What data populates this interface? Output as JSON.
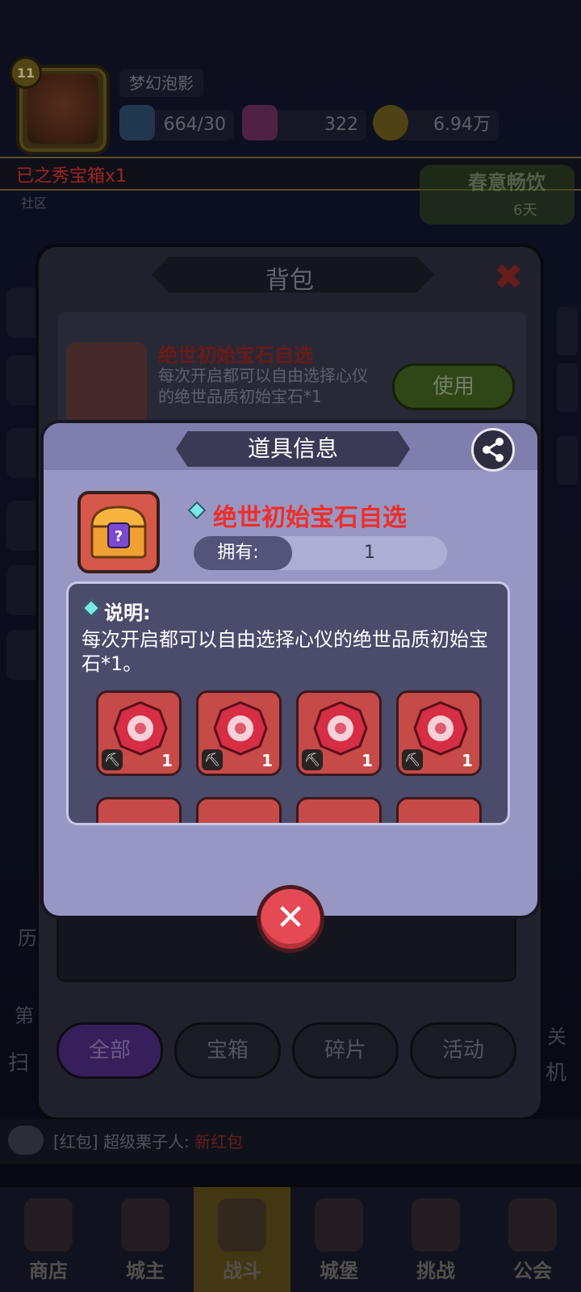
{
  "player": {
    "level": "11",
    "name": "梦幻泡影",
    "energy": "664/30",
    "gems": "322",
    "coins": "6.94万"
  },
  "ticker": {
    "text": "已之秀宝箱x1"
  },
  "community_label": "社区",
  "event": {
    "title": "春意畅饮",
    "days": "6天"
  },
  "backpack": {
    "title": "背包",
    "item_name": "绝世初始宝石自选",
    "item_desc": "每次开启都可以自由选择心仪的绝世品质初始宝石*1",
    "item_count": "1",
    "use_label": "使用",
    "tabs": [
      {
        "label": "全部",
        "active": true
      },
      {
        "label": "宝箱",
        "active": false
      },
      {
        "label": "碎片",
        "active": false
      },
      {
        "label": "活动",
        "active": false
      }
    ]
  },
  "dialog": {
    "title": "道具信息",
    "item_name": "绝世初始宝石自选",
    "own_label": "拥有:",
    "own_value": "1",
    "desc_heading": "说明:",
    "desc_text": "每次开启都可以自由选择心仪的绝世品质初始宝石*1。",
    "gem_counts": [
      "1",
      "1",
      "1",
      "1"
    ]
  },
  "redpack": {
    "prefix": "[红包]",
    "sender": "超级栗子人:",
    "status": "新红包"
  },
  "bottom_nav": [
    {
      "label": "商店",
      "active": false
    },
    {
      "label": "城主",
      "active": false
    },
    {
      "label": "战斗",
      "active": true
    },
    {
      "label": "城堡",
      "active": false
    },
    {
      "label": "挑战",
      "active": false
    },
    {
      "label": "公会",
      "active": false
    }
  ],
  "side_labels": {
    "left_a": "历",
    "left_b": "第",
    "left_c": "扫",
    "right_a": "关",
    "right_b": "机"
  },
  "colors": {
    "accent_red": "#ee2e2a",
    "dialog_bg": "#9897c4",
    "close_red": "#e54a54",
    "tab_active": "#4a2a7a"
  }
}
